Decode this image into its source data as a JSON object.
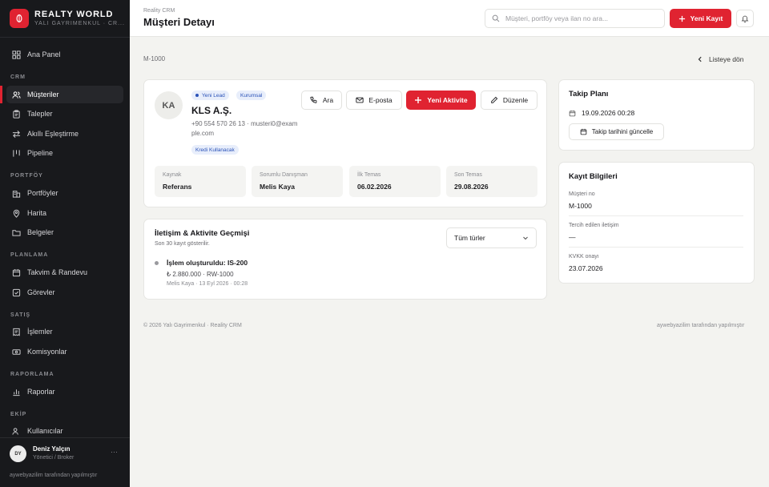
{
  "sidebar": {
    "brand_title": "REALTY WORLD",
    "brand_subtitle": "YALI GAYRIMENKUL · CR...",
    "sections": {
      "crm": "CRM",
      "portfolio": "PORTFÖY",
      "planning": "PLANLAMA",
      "sales": "SATIŞ",
      "reports": "RAPORLAMA",
      "team": "EKİP"
    },
    "items": {
      "dashboard": "Ana Panel",
      "customers": "Müşteriler",
      "requests": "Talepler",
      "matching": "Akıllı Eşleştirme",
      "pipeline": "Pipeline",
      "portfolios": "Portföyler",
      "map": "Harita",
      "documents": "Belgeler",
      "calendar": "Takvim & Randevu",
      "tasks": "Görevler",
      "deals": "İşlemler",
      "commissions": "Komisyonlar",
      "reports": "Raporlar",
      "users": "Kullanıcılar"
    },
    "user": {
      "initials": "DY",
      "name": "Deniz Yalçın",
      "role": "Yönetici / Broker"
    },
    "footer": "aywebyazilim tarafından yapılmıştır"
  },
  "topbar": {
    "breadcrumb": "Reality CRM",
    "title": "Müşteri Detayı",
    "search_placeholder": "Müşteri, portföy veya ilan no ara...",
    "new_record": "Yeni Kayıt"
  },
  "page": {
    "customer_id": "M-1000",
    "back_label": "Listeye dön"
  },
  "customer": {
    "initials": "KA",
    "badges": {
      "lead": "Yeni Lead",
      "type": "Kurumsal",
      "credit": "Kredi Kullanacak"
    },
    "name": "KLS A.Ş.",
    "contact": "+90 554 570 26 13 · musteri0@example.com",
    "actions": {
      "call": "Ara",
      "email": "E-posta",
      "new_activity": "Yeni Aktivite",
      "edit": "Düzenle"
    },
    "info": [
      {
        "label": "Kaynak",
        "value": "Referans"
      },
      {
        "label": "Sorumlu Danışman",
        "value": "Melis Kaya"
      },
      {
        "label": "İlk Temas",
        "value": "06.02.2026"
      },
      {
        "label": "Son Temas",
        "value": "29.08.2026"
      }
    ]
  },
  "history": {
    "title": "İletişim & Aktivite Geçmişi",
    "subtitle": "Son 30 kayıt gösterilir.",
    "filter": "Tüm türler",
    "items": [
      {
        "title": "İşlem oluşturuldu: IS-200",
        "detail": "₺ 2.880.000 · RW-1000",
        "meta": "Melis Kaya · 13 Eyl 2026 · 00:28"
      }
    ]
  },
  "followup": {
    "title": "Takip Planı",
    "date": "19.09.2026 00:28",
    "update_button": "Takip tarihini güncelle"
  },
  "record": {
    "title": "Kayıt Bilgileri",
    "fields": [
      {
        "label": "Müşteri no",
        "value": "M-1000"
      },
      {
        "label": "Tercih edilen iletişim",
        "value": "—"
      },
      {
        "label": "KVKK onayı",
        "value": "23.07.2026"
      }
    ]
  },
  "footer": {
    "left": "© 2026 Yalı Gayrimenkul · Reality CRM",
    "right": "aywebyazilim tarafından yapılmıştır"
  },
  "colors": {
    "accent": "#e02331",
    "sidebar_bg": "#18191c",
    "page_bg": "#f3f3f0",
    "badge_blue": "#2a52b8"
  }
}
